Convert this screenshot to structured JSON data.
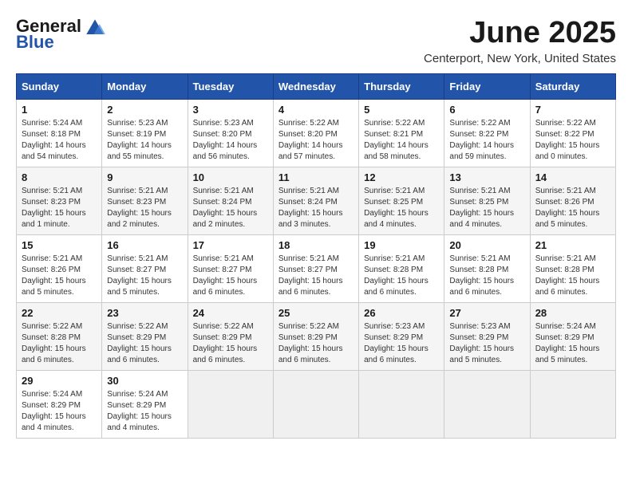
{
  "logo": {
    "general": "General",
    "blue": "Blue"
  },
  "title": "June 2025",
  "location": "Centerport, New York, United States",
  "days_header": [
    "Sunday",
    "Monday",
    "Tuesday",
    "Wednesday",
    "Thursday",
    "Friday",
    "Saturday"
  ],
  "weeks": [
    [
      {
        "day": "1",
        "info": "Sunrise: 5:24 AM\nSunset: 8:18 PM\nDaylight: 14 hours\nand 54 minutes."
      },
      {
        "day": "2",
        "info": "Sunrise: 5:23 AM\nSunset: 8:19 PM\nDaylight: 14 hours\nand 55 minutes."
      },
      {
        "day": "3",
        "info": "Sunrise: 5:23 AM\nSunset: 8:20 PM\nDaylight: 14 hours\nand 56 minutes."
      },
      {
        "day": "4",
        "info": "Sunrise: 5:22 AM\nSunset: 8:20 PM\nDaylight: 14 hours\nand 57 minutes."
      },
      {
        "day": "5",
        "info": "Sunrise: 5:22 AM\nSunset: 8:21 PM\nDaylight: 14 hours\nand 58 minutes."
      },
      {
        "day": "6",
        "info": "Sunrise: 5:22 AM\nSunset: 8:22 PM\nDaylight: 14 hours\nand 59 minutes."
      },
      {
        "day": "7",
        "info": "Sunrise: 5:22 AM\nSunset: 8:22 PM\nDaylight: 15 hours\nand 0 minutes."
      }
    ],
    [
      {
        "day": "8",
        "info": "Sunrise: 5:21 AM\nSunset: 8:23 PM\nDaylight: 15 hours\nand 1 minute."
      },
      {
        "day": "9",
        "info": "Sunrise: 5:21 AM\nSunset: 8:23 PM\nDaylight: 15 hours\nand 2 minutes."
      },
      {
        "day": "10",
        "info": "Sunrise: 5:21 AM\nSunset: 8:24 PM\nDaylight: 15 hours\nand 2 minutes."
      },
      {
        "day": "11",
        "info": "Sunrise: 5:21 AM\nSunset: 8:24 PM\nDaylight: 15 hours\nand 3 minutes."
      },
      {
        "day": "12",
        "info": "Sunrise: 5:21 AM\nSunset: 8:25 PM\nDaylight: 15 hours\nand 4 minutes."
      },
      {
        "day": "13",
        "info": "Sunrise: 5:21 AM\nSunset: 8:25 PM\nDaylight: 15 hours\nand 4 minutes."
      },
      {
        "day": "14",
        "info": "Sunrise: 5:21 AM\nSunset: 8:26 PM\nDaylight: 15 hours\nand 5 minutes."
      }
    ],
    [
      {
        "day": "15",
        "info": "Sunrise: 5:21 AM\nSunset: 8:26 PM\nDaylight: 15 hours\nand 5 minutes."
      },
      {
        "day": "16",
        "info": "Sunrise: 5:21 AM\nSunset: 8:27 PM\nDaylight: 15 hours\nand 5 minutes."
      },
      {
        "day": "17",
        "info": "Sunrise: 5:21 AM\nSunset: 8:27 PM\nDaylight: 15 hours\nand 6 minutes."
      },
      {
        "day": "18",
        "info": "Sunrise: 5:21 AM\nSunset: 8:27 PM\nDaylight: 15 hours\nand 6 minutes."
      },
      {
        "day": "19",
        "info": "Sunrise: 5:21 AM\nSunset: 8:28 PM\nDaylight: 15 hours\nand 6 minutes."
      },
      {
        "day": "20",
        "info": "Sunrise: 5:21 AM\nSunset: 8:28 PM\nDaylight: 15 hours\nand 6 minutes."
      },
      {
        "day": "21",
        "info": "Sunrise: 5:21 AM\nSunset: 8:28 PM\nDaylight: 15 hours\nand 6 minutes."
      }
    ],
    [
      {
        "day": "22",
        "info": "Sunrise: 5:22 AM\nSunset: 8:28 PM\nDaylight: 15 hours\nand 6 minutes."
      },
      {
        "day": "23",
        "info": "Sunrise: 5:22 AM\nSunset: 8:29 PM\nDaylight: 15 hours\nand 6 minutes."
      },
      {
        "day": "24",
        "info": "Sunrise: 5:22 AM\nSunset: 8:29 PM\nDaylight: 15 hours\nand 6 minutes."
      },
      {
        "day": "25",
        "info": "Sunrise: 5:22 AM\nSunset: 8:29 PM\nDaylight: 15 hours\nand 6 minutes."
      },
      {
        "day": "26",
        "info": "Sunrise: 5:23 AM\nSunset: 8:29 PM\nDaylight: 15 hours\nand 6 minutes."
      },
      {
        "day": "27",
        "info": "Sunrise: 5:23 AM\nSunset: 8:29 PM\nDaylight: 15 hours\nand 5 minutes."
      },
      {
        "day": "28",
        "info": "Sunrise: 5:24 AM\nSunset: 8:29 PM\nDaylight: 15 hours\nand 5 minutes."
      }
    ],
    [
      {
        "day": "29",
        "info": "Sunrise: 5:24 AM\nSunset: 8:29 PM\nDaylight: 15 hours\nand 4 minutes."
      },
      {
        "day": "30",
        "info": "Sunrise: 5:24 AM\nSunset: 8:29 PM\nDaylight: 15 hours\nand 4 minutes."
      },
      {
        "day": "",
        "info": ""
      },
      {
        "day": "",
        "info": ""
      },
      {
        "day": "",
        "info": ""
      },
      {
        "day": "",
        "info": ""
      },
      {
        "day": "",
        "info": ""
      }
    ]
  ]
}
